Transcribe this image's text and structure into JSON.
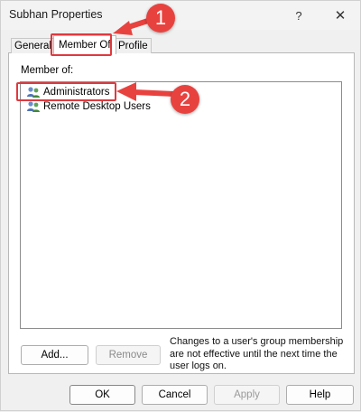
{
  "window": {
    "title": "Subhan Properties",
    "help_glyph": "?",
    "close_glyph": "✕"
  },
  "tabs": [
    {
      "label": "General",
      "active": false
    },
    {
      "label": "Member Of",
      "active": true
    },
    {
      "label": "Profile",
      "active": false
    }
  ],
  "member_of": {
    "label": "Member of:",
    "groups": [
      {
        "name": "Administrators",
        "icon": "group-icon"
      },
      {
        "name": "Remote Desktop Users",
        "icon": "group-icon"
      }
    ]
  },
  "buttons": {
    "add": "Add...",
    "remove": "Remove",
    "ok": "OK",
    "cancel": "Cancel",
    "apply": "Apply",
    "help": "Help"
  },
  "note": "Changes to a user's group membership are not effective until the next time the user logs on.",
  "annotations": {
    "step1": "1",
    "step2": "2",
    "color": "#e8423f"
  }
}
